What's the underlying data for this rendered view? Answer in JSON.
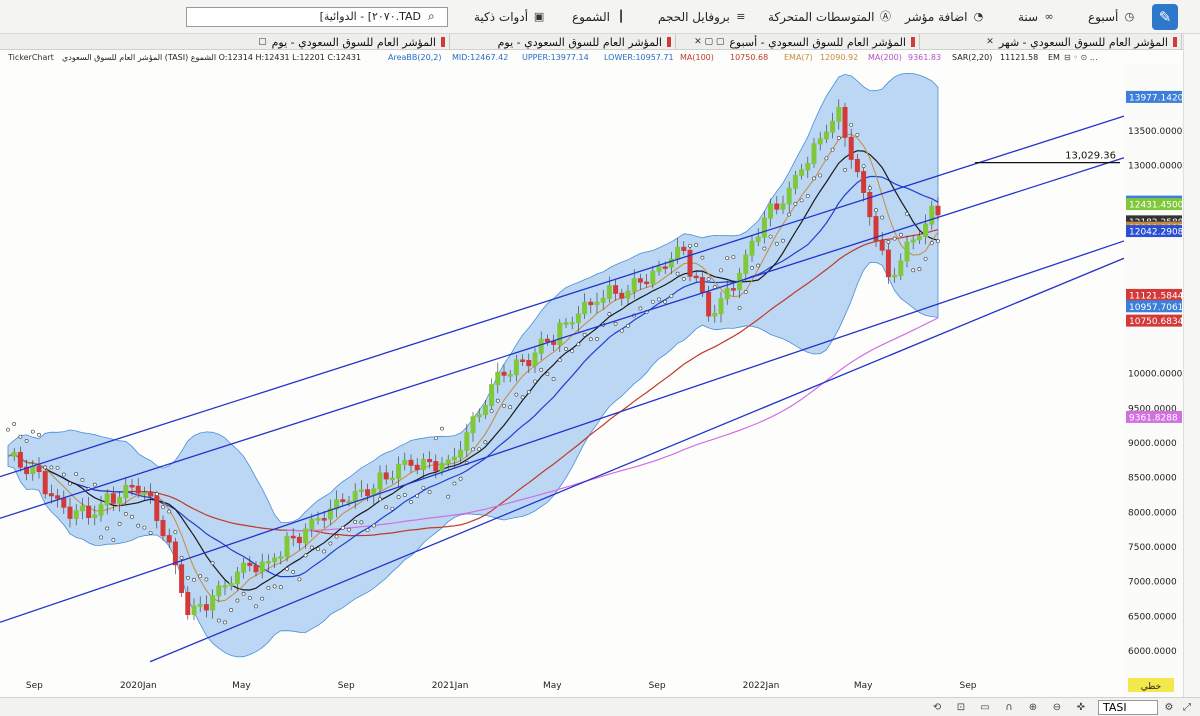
{
  "toolbar": {
    "items": [
      {
        "label": "أسبوع",
        "icon": "clock-icon"
      },
      {
        "label": "سنة",
        "icon": "link-icon"
      },
      {
        "label": "اضافة مؤشر",
        "icon": "gauge-icon"
      },
      {
        "label": "المتوسطات المتحركة",
        "icon": "letter-a-icon"
      },
      {
        "label": "بروفايل الحجم",
        "icon": "volume-profile-icon"
      },
      {
        "label": "الشموع",
        "icon": "candles-icon"
      },
      {
        "label": "أدوات ذكية",
        "icon": "smart-tools-icon"
      }
    ],
    "search_value": "TAD.٢٠٧٠] - الدوائية]"
  },
  "tabs": [
    {
      "label": "المؤشر العام للسوق السعودي - شهر"
    },
    {
      "label": "المؤشر العام للسوق السعودي - أسبوع"
    },
    {
      "label": "المؤشر العام للسوق السعودي - يوم"
    },
    {
      "label": "المؤشر العام للسوق السعودي - يوم"
    }
  ],
  "info": {
    "ticker_label": "TickerChart",
    "ohlc": "المؤشر العام للسوق السعودي (TASI) الشموع O:12314 H:12431 L:12201 C:12431",
    "area_bb": "AreaBB(20,2)",
    "mid": "MID:12467.42",
    "upper": "UPPER:13977.14",
    "lower": "LOWER:10957.71",
    "ma100": "MA(100)",
    "ma100_val": "10750.68",
    "ema7": "EMA(7)",
    "ema7_val": "12090.92",
    "ma200": "MA(200)",
    "ma200_val": "9361.83",
    "sar": "SAR(2,20)",
    "sar_val": "11121.58",
    "em": "EM"
  },
  "colors": {
    "up": "#7ec83a",
    "down": "#d23a3a",
    "band_fill": "#6aa8e8",
    "channel": "#2233cc",
    "ma100": "#c0392b",
    "ma200": "#d36fe0",
    "ema": "#1a1a1a",
    "ema_alt": "#c58b3e",
    "sar": "#ffffff"
  },
  "chart_data": {
    "type": "line",
    "price_axis_ticks": [
      "13500.0000",
      "13000.0000",
      "10000.0000",
      "9500.0000",
      "9000.0000",
      "8500.0000",
      "8000.0000",
      "7500.0000",
      "7000.0000",
      "6500.0000",
      "6000.0000"
    ],
    "price_tags": [
      {
        "label": "13977.1420",
        "value": 13977.14,
        "color": "#3b7fd8"
      },
      {
        "label": "12467.4241",
        "value": 12467.42,
        "color": "#3b7fd8"
      },
      {
        "label": "12431.4500",
        "value": 12431.45,
        "color": "#7ec83a"
      },
      {
        "label": "12182.2588",
        "value": 12182.26,
        "color": "#333333"
      },
      {
        "label": "12099.0312",
        "value": 12099.03,
        "color": "#333333"
      },
      {
        "label": "12090.9195",
        "value": 12090.92,
        "color": "#c58b3e"
      },
      {
        "label": "12042.2908",
        "value": 12042.29,
        "color": "#2b4fd4"
      },
      {
        "label": "11121.5844",
        "value": 11121.58,
        "color": "#d23a3a"
      },
      {
        "label": "10957.7061",
        "value": 10957.71,
        "color": "#3b7fd8"
      },
      {
        "label": "10750.6834",
        "value": 10750.68,
        "color": "#d23a3a"
      },
      {
        "label": "9361.8288",
        "value": 9361.83,
        "color": "#d36fe0"
      }
    ],
    "horizontal_line": {
      "label": "13,029.36",
      "value": 13029.36
    },
    "x_labels": [
      "Sep",
      "2020Jan",
      "May",
      "Sep",
      "2021Jan",
      "May",
      "Sep",
      "2022Jan",
      "May",
      "Sep"
    ],
    "close_path": [
      [
        "2019-08",
        8800
      ],
      [
        "2019-09",
        8600
      ],
      [
        "2019-10",
        8050
      ],
      [
        "2019-11",
        7950
      ],
      [
        "2019-12",
        8200
      ],
      [
        "2020-01",
        8400
      ],
      [
        "2020-02",
        7700
      ],
      [
        "2020-03",
        6500
      ],
      [
        "2020-04",
        6800
      ],
      [
        "2020-05",
        7200
      ],
      [
        "2020-06",
        7250
      ],
      [
        "2020-07",
        7600
      ],
      [
        "2020-08",
        7900
      ],
      [
        "2020-09",
        8250
      ],
      [
        "2020-10",
        8300
      ],
      [
        "2020-11",
        8650
      ],
      [
        "2020-12",
        8690
      ],
      [
        "2021-01",
        8700
      ],
      [
        "2021-02",
        9300
      ],
      [
        "2021-03",
        10000
      ],
      [
        "2021-04",
        10200
      ],
      [
        "2021-05",
        10500
      ],
      [
        "2021-06",
        10900
      ],
      [
        "2021-07",
        11100
      ],
      [
        "2021-08",
        11200
      ],
      [
        "2021-09",
        11500
      ],
      [
        "2021-10",
        11750
      ],
      [
        "2021-11",
        10900
      ],
      [
        "2021-12",
        11250
      ],
      [
        "2022-01",
        12200
      ],
      [
        "2022-02",
        12600
      ],
      [
        "2022-03",
        13200
      ],
      [
        "2022-04",
        13800
      ],
      [
        "2022-05",
        12600
      ],
      [
        "2022-06",
        11300
      ],
      [
        "2022-07",
        12000
      ],
      [
        "2022-08",
        12431
      ]
    ]
  },
  "statusbar": {
    "ticker": "TASI",
    "tag": "خطي"
  }
}
